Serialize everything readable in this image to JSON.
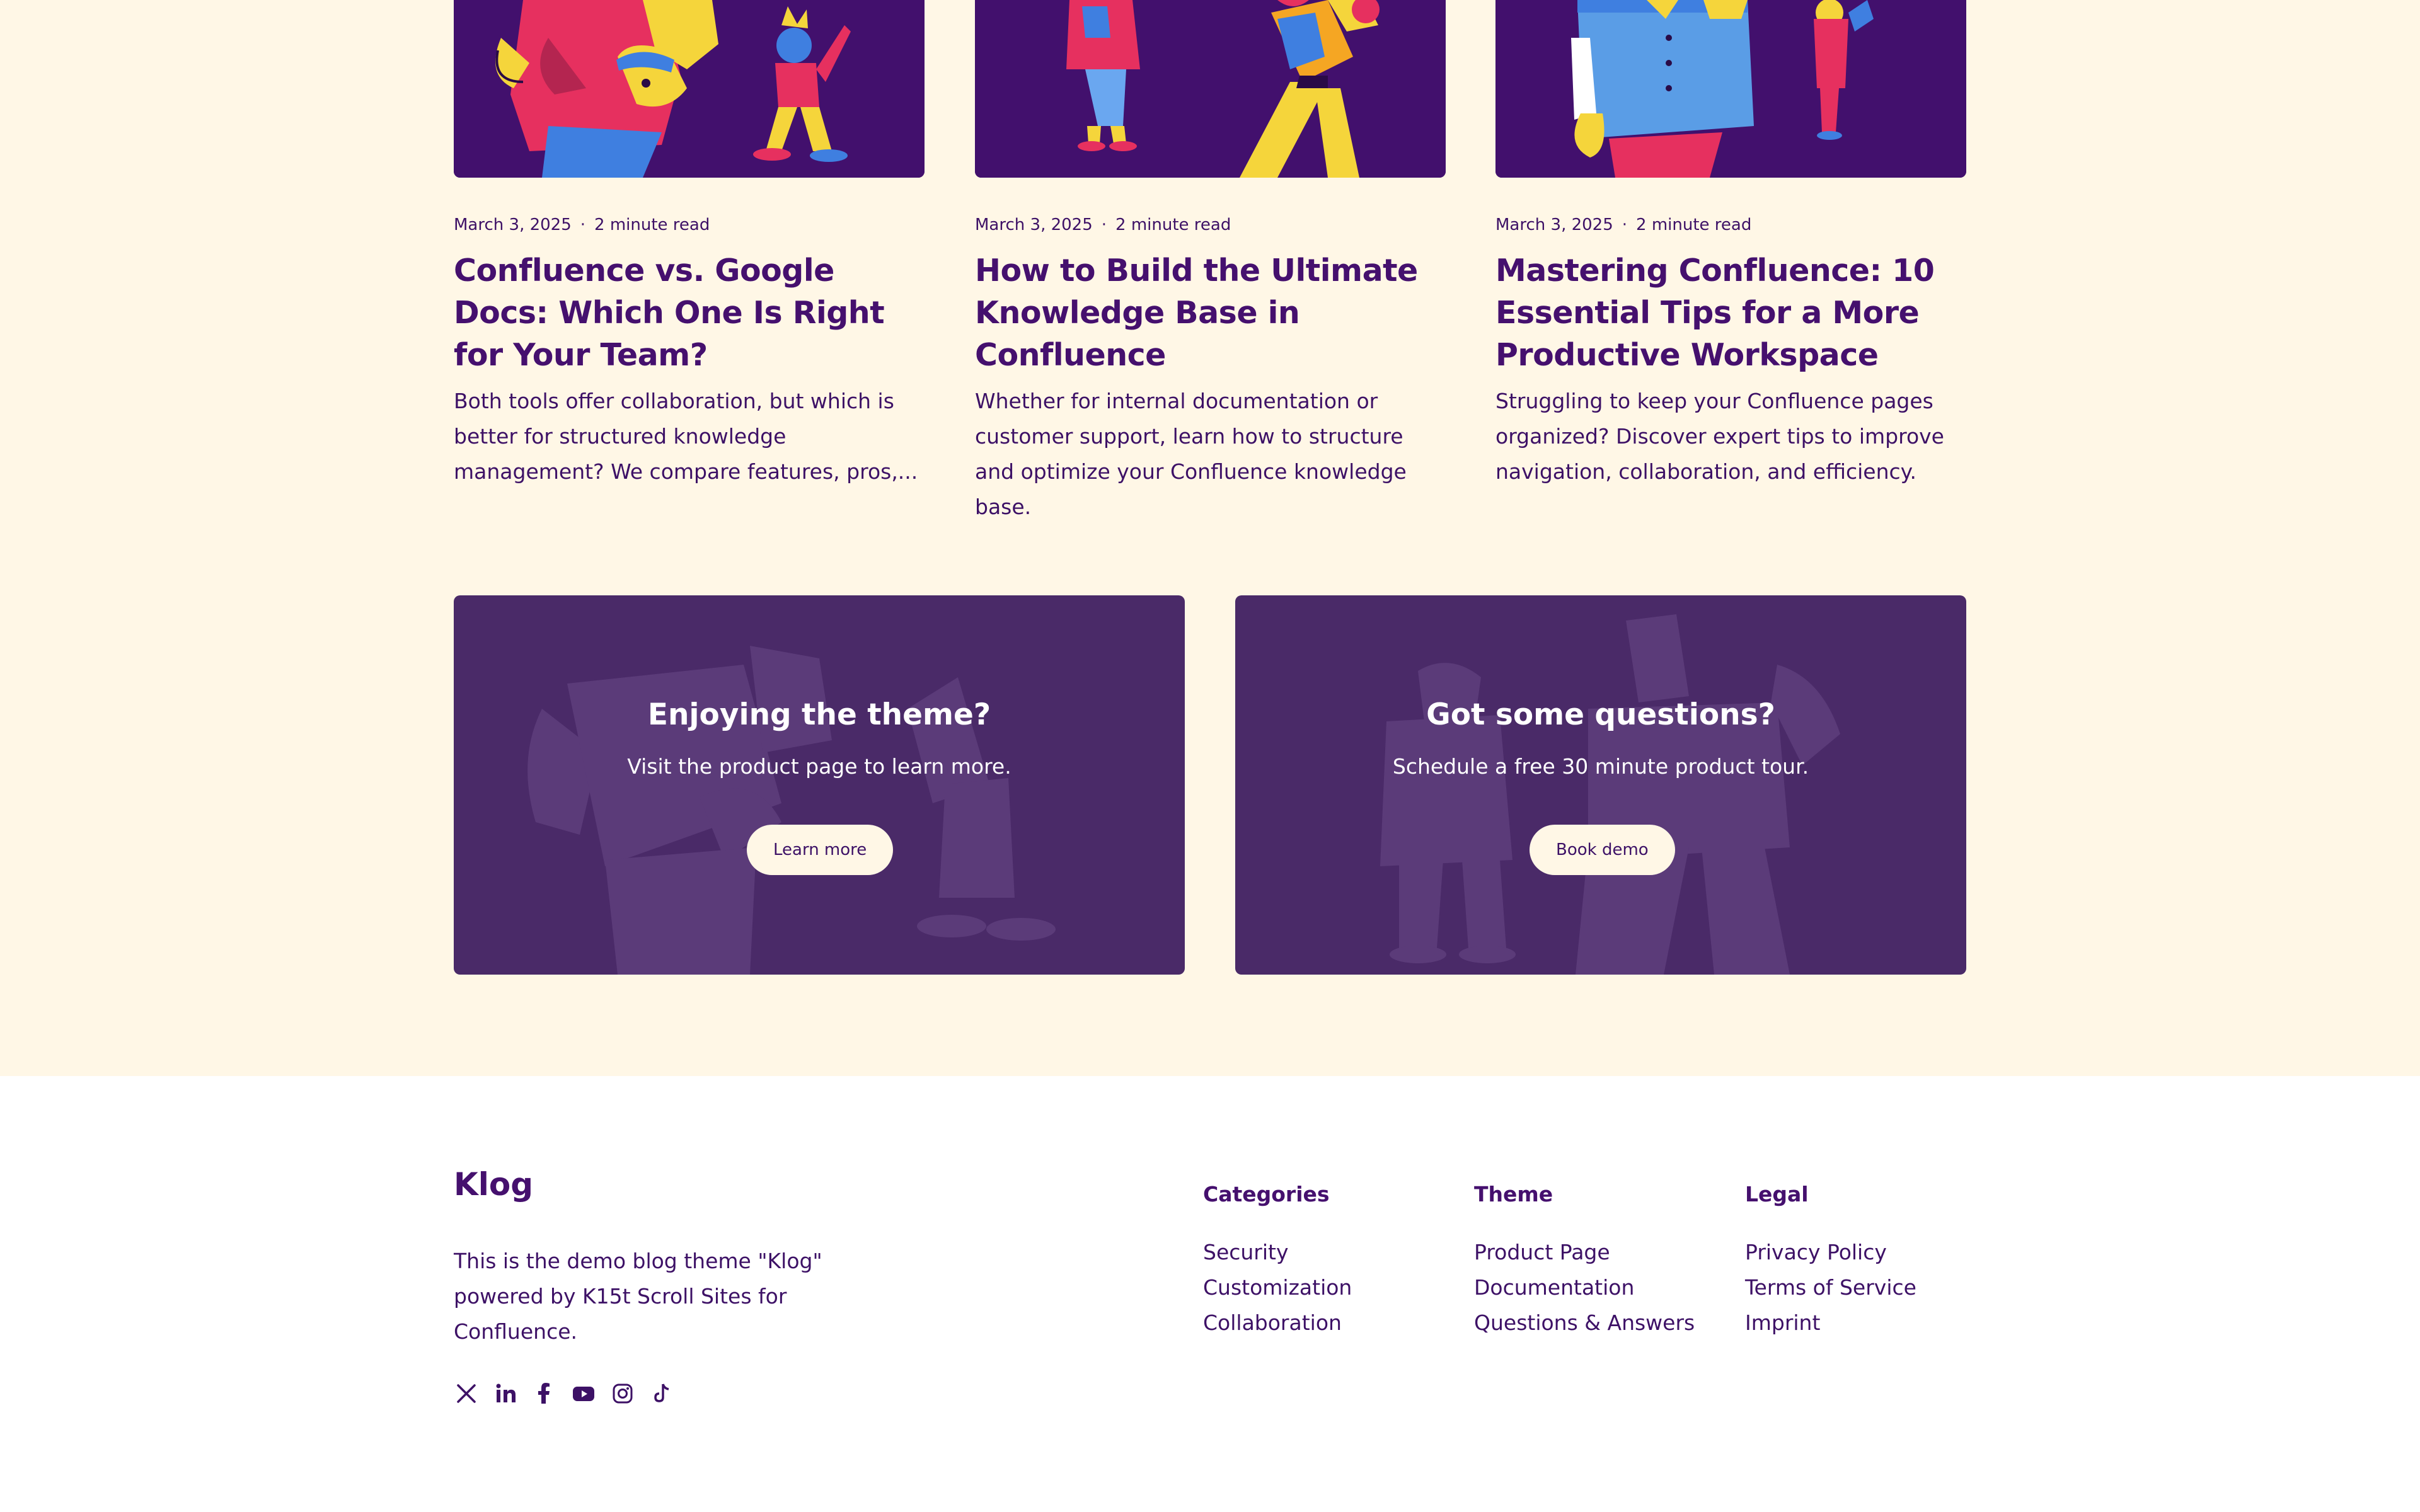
{
  "colors": {
    "cream_background": "#fff7e6",
    "brand_purple": "#45106e",
    "card_image_background": "#42106d",
    "cta_background": "#4a2a68",
    "footer_background": "#ffffff"
  },
  "articles": [
    {
      "date": "March 3, 2025",
      "separator": "·",
      "read_time": "2 minute read",
      "title": "Confluence vs. Google Docs: Which One Is Right for Your Team?",
      "excerpt": "Both tools offer collaboration, but which is better for structured knowledge management? We compare features, pros,..."
    },
    {
      "date": "March 3, 2025",
      "separator": "·",
      "read_time": "2 minute read",
      "title": "How to Build the Ultimate Knowledge Base in Confluence",
      "excerpt": "Whether for internal documentation or customer support, learn how to structure and optimize your Confluence knowledge base."
    },
    {
      "date": "March 3, 2025",
      "separator": "·",
      "read_time": "2 minute read",
      "title": "Mastering Confluence: 10 Essential Tips for a More Productive Workspace",
      "excerpt": "Struggling to keep your Confluence pages organized? Discover expert tips to improve navigation, collaboration, and efficiency."
    }
  ],
  "cta": [
    {
      "title": "Enjoying the theme?",
      "text": "Visit the product page to learn more.",
      "button": "Learn more"
    },
    {
      "title": "Got some questions?",
      "text": "Schedule a free 30 minute product tour.",
      "button": "Book demo"
    }
  ],
  "footer": {
    "brand": "Klog",
    "description": "This is the demo blog theme \"Klog\" powered by K15t Scroll Sites for Confluence.",
    "social_icons": [
      "x-icon",
      "linkedin-icon",
      "facebook-icon",
      "youtube-icon",
      "instagram-icon",
      "tiktok-icon"
    ],
    "columns": [
      {
        "title": "Categories",
        "links": [
          "Security",
          "Customization",
          "Collaboration"
        ]
      },
      {
        "title": "Theme",
        "links": [
          "Product Page",
          "Documentation",
          "Questions & Answers"
        ]
      },
      {
        "title": "Legal",
        "links": [
          "Privacy Policy",
          "Terms of Service",
          "Imprint"
        ]
      }
    ]
  }
}
